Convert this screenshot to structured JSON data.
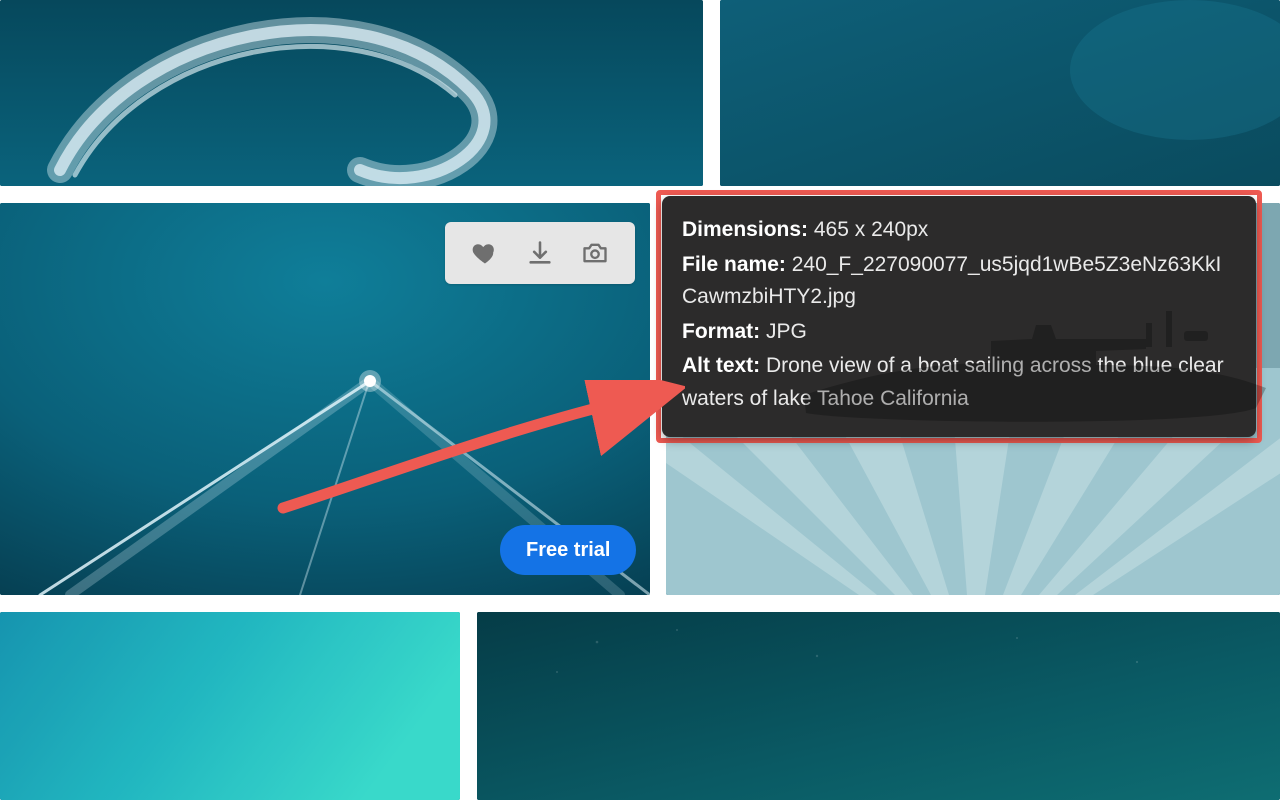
{
  "actions": {
    "favorite_title": "Add to favorites",
    "download_title": "Download",
    "similar_title": "Find similar"
  },
  "cta": {
    "free_trial": "Free trial"
  },
  "tooltip": {
    "dimensions_label": "Dimensions:",
    "dimensions_value": "465 x 240px",
    "filename_label": "File name:",
    "filename_value": "240_F_227090077_us5jqd1wBe5Z3eNz63KkICawmzbiHTY2.jpg",
    "format_label": "Format:",
    "format_value": "JPG",
    "alttext_label": "Alt text:",
    "alttext_value": "Drone view of a boat sailing across the blue clear waters of lake Tahoe California"
  },
  "annotation": {
    "arrow_color": "#ee5a52"
  }
}
